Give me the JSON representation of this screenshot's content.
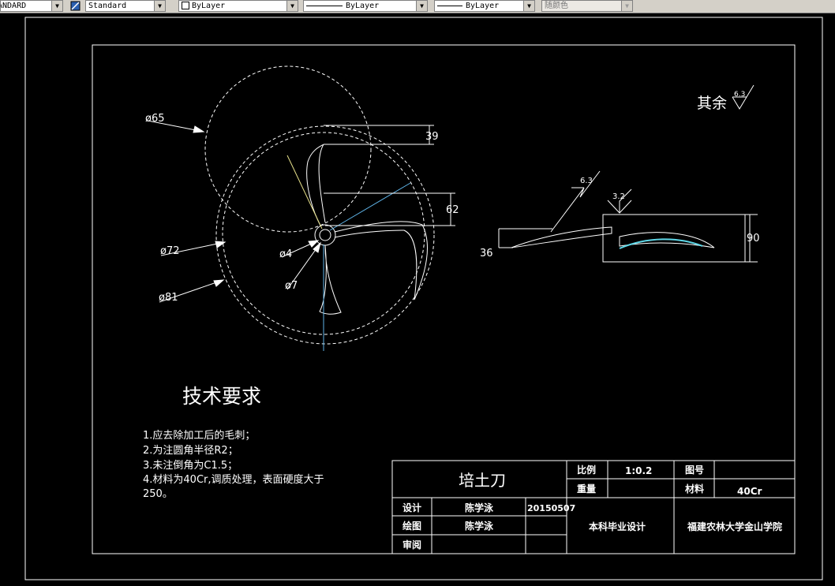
{
  "toolbar": {
    "text_style": "ANDARD",
    "dim_style": "Standard",
    "layer": "ByLayer",
    "linetype": "ByLayer",
    "lineweight": "ByLayer",
    "color": "随颜色"
  },
  "drawing": {
    "dimensions": {
      "d65": "ø65",
      "d72": "ø72",
      "d81": "ø81",
      "d4": "ø4",
      "d7": "ø7",
      "v39": "39",
      "v62": "62",
      "v36": "36",
      "v90": "90"
    },
    "surface_marks": {
      "rest_label": "其余",
      "rest_value": "6.3",
      "mark1": "6.3",
      "mark2": "3.2"
    },
    "tech_req": {
      "title": "技术要求",
      "items": [
        "1.应去除加工后的毛刺；",
        "2.为注圆角半径R2；",
        "3.未注倒角为C1.5；",
        "4.材料为40Cr,调质处理，表面硬度大于",
        "250。"
      ]
    },
    "title_block": {
      "part_name": "培土刀",
      "scale_label": "比例",
      "scale_value": "1:0.2",
      "drawing_no_label": "图号",
      "weight_label": "重量",
      "material_label": "材料",
      "material_value": "40Cr",
      "design_label": "设计",
      "designer": "陈学泳",
      "date": "20150507",
      "drawn_label": "绘图",
      "drawer": "陈学泳",
      "review_label": "审阅",
      "project": "本科毕业设计",
      "school": "福建农林大学金山学院"
    }
  }
}
